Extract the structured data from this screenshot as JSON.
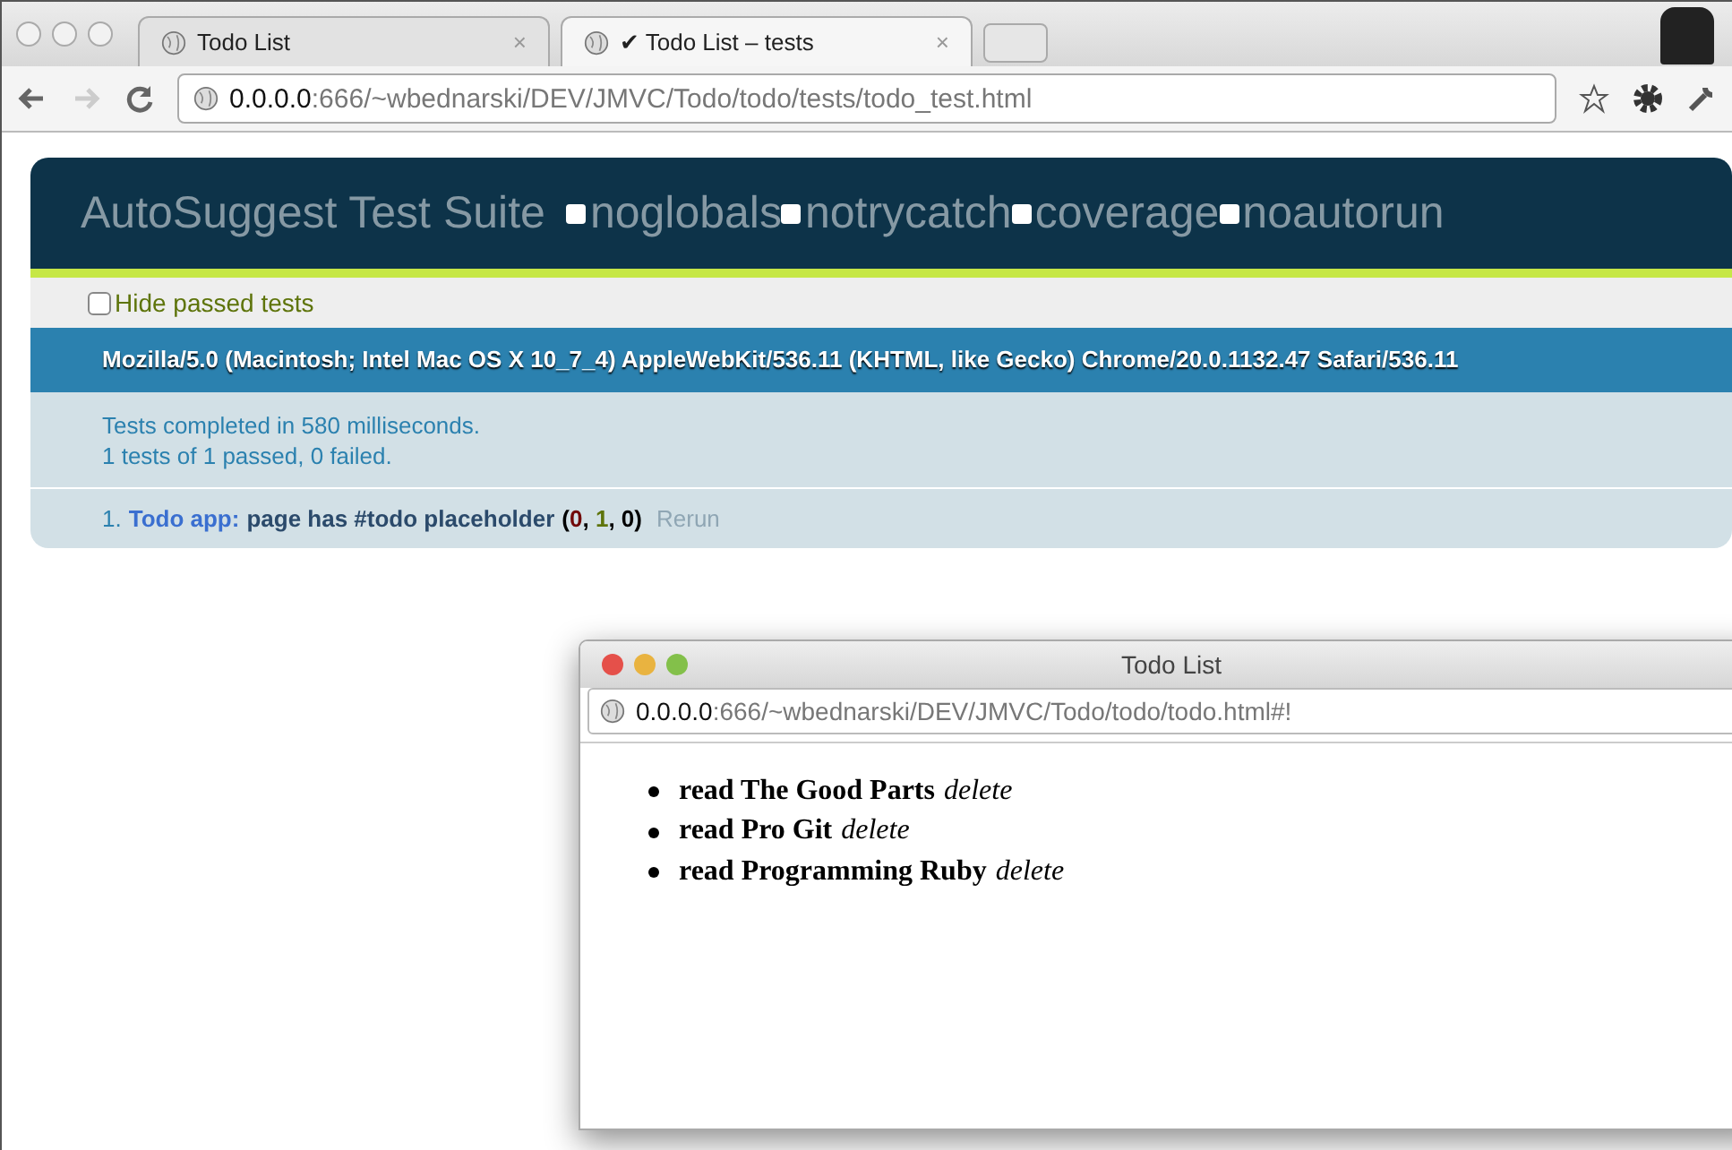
{
  "browser": {
    "tabs": [
      {
        "title": "Todo List",
        "close": "×",
        "selected": false
      },
      {
        "title": "✔ Todo List – tests",
        "close": "×",
        "selected": true
      }
    ],
    "url": {
      "host": "0.0.0.0",
      "path": ":666/~wbednarski/DEV/JMVC/Todo/todo/tests/todo_test.html"
    }
  },
  "suite": {
    "title": "AutoSuggest Test Suite",
    "options": [
      {
        "label": "noglobals",
        "checked": false
      },
      {
        "label": "notrycatch",
        "checked": false
      },
      {
        "label": "coverage",
        "checked": false
      },
      {
        "label": "noautorun",
        "checked": false
      }
    ],
    "hide_passed": {
      "label": "Hide passed tests",
      "checked": false
    },
    "user_agent": "Mozilla/5.0 (Macintosh; Intel Mac OS X 10_7_4) AppleWebKit/536.11 (KHTML, like Gecko) Chrome/20.0.1132.47 Safari/536.11",
    "summary": [
      "Tests completed in 580 milliseconds.",
      "1 tests of 1 passed, 0 failed."
    ],
    "tests": [
      {
        "number": "1.",
        "module": "Todo app:",
        "name": "page has #todo placeholder",
        "open": "(",
        "separator": ", ",
        "close": ")",
        "counts": [
          {
            "value": "0",
            "color": "#710909"
          },
          {
            "value": "1",
            "color": "#5e740b"
          },
          {
            "value": "0",
            "color": "#000000"
          }
        ],
        "rerun": "Rerun"
      }
    ]
  },
  "popup": {
    "title": "Todo List",
    "url": {
      "host": "0.0.0.0",
      "path": ":666/~wbednarski/DEV/JMVC/Todo/todo/todo.html#!"
    },
    "items": [
      {
        "text": "read The Good Parts",
        "action": "delete"
      },
      {
        "text": "read Pro Git",
        "action": "delete"
      },
      {
        "text": "read Programming Ruby",
        "action": "delete"
      }
    ]
  }
}
